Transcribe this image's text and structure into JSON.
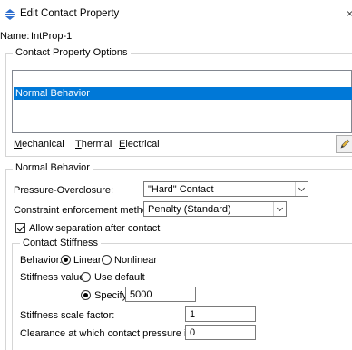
{
  "window": {
    "title": "Edit Contact Property",
    "close": "×",
    "icon": "contact-property-icon"
  },
  "name": {
    "label": "Name:",
    "value": "IntProp-1"
  },
  "options": {
    "group_label": "Contact Property Options",
    "list_items": [
      "Normal Behavior"
    ],
    "selected_index": 0
  },
  "menu": {
    "mechanical": {
      "first": "M",
      "rest": "echanical"
    },
    "thermal": {
      "first": "T",
      "rest": "hermal"
    },
    "electrical": {
      "first": "E",
      "rest": "lectrical"
    },
    "tool_icon": "pencil-icon"
  },
  "normal_behavior": {
    "group_label": "Normal Behavior",
    "pressure_overclosure": {
      "label": "Pressure-Overclosure:",
      "value": "\"Hard\" Contact"
    },
    "constraint_method": {
      "label": "Constraint enforcement method:",
      "value": "Penalty (Standard)"
    },
    "allow_separation": {
      "label": "Allow separation after contact",
      "checked": true
    }
  },
  "contact_stiffness": {
    "group_label": "Contact Stiffness",
    "behavior_label": "Behavior:",
    "linear": "Linear",
    "nonlinear": "Nonlinear",
    "behavior_selected": "Linear",
    "stiffness_value_label": "Stiffness value:",
    "use_default": "Use default",
    "specify": {
      "label": "Specify:",
      "value": "5000"
    },
    "stiffness_selected": "Specify",
    "scale_factor": {
      "label": "Stiffness scale factor:",
      "value": "1"
    },
    "clearance": {
      "label": "Clearance at which contact pressure is zero:",
      "value": "0"
    }
  },
  "colors": {
    "selection": "#0078d7",
    "border": "#d5d5d5"
  }
}
